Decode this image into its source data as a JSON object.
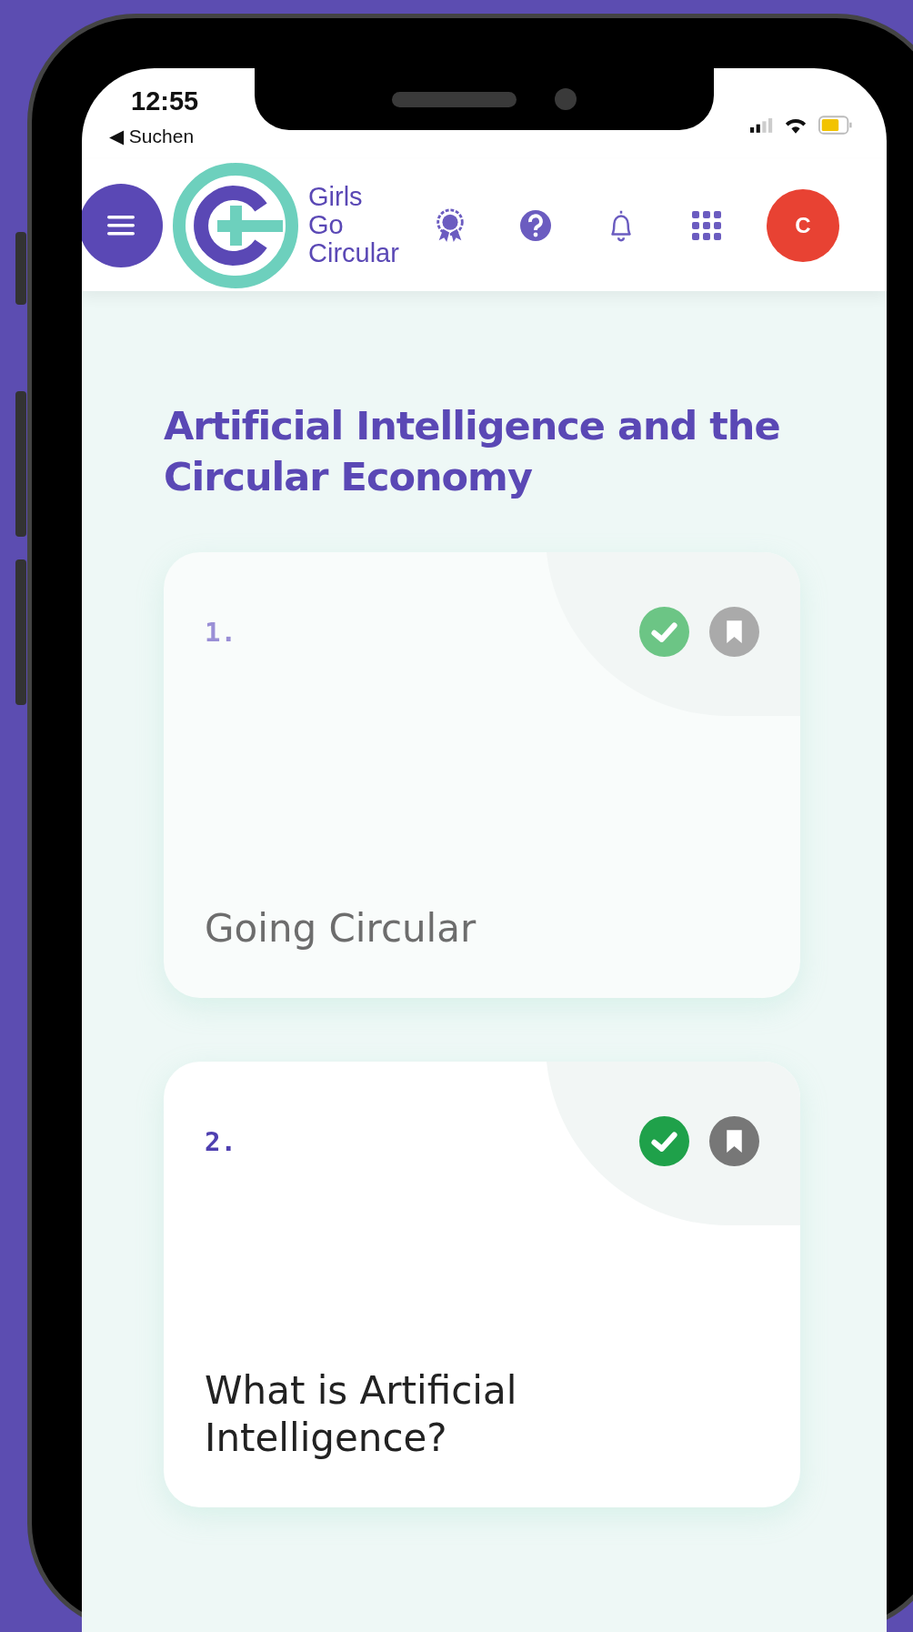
{
  "status_bar": {
    "time": "12:55",
    "back_link": "◀ Suchen"
  },
  "header": {
    "brand": [
      "Girls",
      "Go",
      "Circular"
    ],
    "avatar_initial": "C"
  },
  "page": {
    "title": "Artificial Intelligence and the Circular Economy"
  },
  "lessons": [
    {
      "number": "1.",
      "title": "Going Circular",
      "completed": true,
      "dimmed": true
    },
    {
      "number": "2.",
      "title": "What is Artificial Intelligence?",
      "completed": true,
      "dimmed": false
    }
  ]
}
